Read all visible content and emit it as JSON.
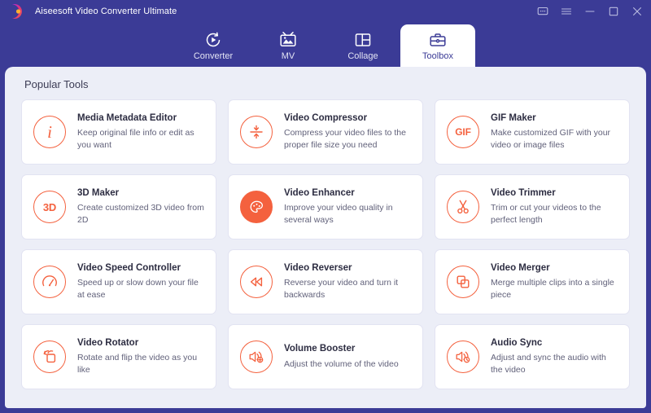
{
  "window": {
    "app_title": "Aiseesoft Video Converter Ultimate",
    "logo_icon": "aiseesoft-logo",
    "brand_bg": "#3b3b96",
    "accent": "#f4613e",
    "panel_bg": "#eceef7",
    "controls": [
      {
        "name": "feedback-icon",
        "label": "Feedback"
      },
      {
        "name": "menu-icon",
        "label": "Menu"
      },
      {
        "name": "minimize-icon",
        "label": "Minimize"
      },
      {
        "name": "maximize-icon",
        "label": "Maximize"
      },
      {
        "name": "close-icon",
        "label": "Close"
      }
    ]
  },
  "tabs": [
    {
      "label": "Converter",
      "icon": "converter-icon",
      "active": false
    },
    {
      "label": "MV",
      "icon": "mv-icon",
      "active": false
    },
    {
      "label": "Collage",
      "icon": "collage-icon",
      "active": false
    },
    {
      "label": "Toolbox",
      "icon": "toolbox-icon",
      "active": true
    }
  ],
  "main": {
    "section_title": "Popular Tools",
    "tools": [
      {
        "title": "Media Metadata Editor",
        "desc": "Keep original file info or edit as you want",
        "icon": "info-icon"
      },
      {
        "title": "Video Compressor",
        "desc": "Compress your video files to the proper file size you need",
        "icon": "compress-icon"
      },
      {
        "title": "GIF Maker",
        "desc": "Make customized GIF with your video or image files",
        "icon": "gif-icon"
      },
      {
        "title": "3D Maker",
        "desc": "Create customized 3D video from 2D",
        "icon": "3d-icon"
      },
      {
        "title": "Video Enhancer",
        "desc": "Improve your video quality in several ways",
        "icon": "palette-icon"
      },
      {
        "title": "Video Trimmer",
        "desc": "Trim or cut your videos to the perfect length",
        "icon": "scissors-icon"
      },
      {
        "title": "Video Speed Controller",
        "desc": "Speed up or slow down your file at ease",
        "icon": "speedometer-icon"
      },
      {
        "title": "Video Reverser",
        "desc": "Reverse your video and turn it backwards",
        "icon": "rewind-icon"
      },
      {
        "title": "Video Merger",
        "desc": "Merge multiple clips into a single piece",
        "icon": "merge-icon"
      },
      {
        "title": "Video Rotator",
        "desc": "Rotate and flip the video as you like",
        "icon": "rotate-icon"
      },
      {
        "title": "Volume Booster",
        "desc": "Adjust the volume of the video",
        "icon": "volume-plus-icon"
      },
      {
        "title": "Audio Sync",
        "desc": "Adjust and sync the audio with the video",
        "icon": "audio-sync-icon"
      }
    ]
  }
}
